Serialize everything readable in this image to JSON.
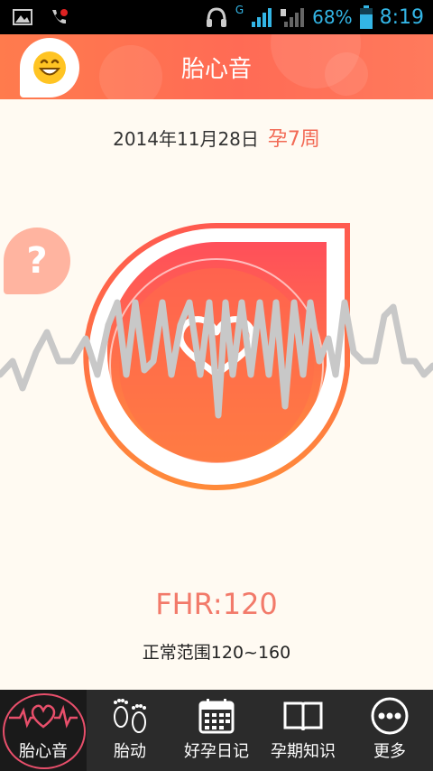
{
  "status_bar": {
    "battery": "68%",
    "time": "8:19",
    "network": "G"
  },
  "header": {
    "title": "胎心音",
    "avatar_icon": "smiley-face-icon"
  },
  "main": {
    "date": "2014年11月28日",
    "pregnancy_week": "孕7周",
    "help_label": "?",
    "fhr_label": "FHR:120",
    "normal_range": "正常范围120~160"
  },
  "nav": {
    "items": [
      {
        "label": "胎心音",
        "icon": "heartbeat-icon",
        "active": true
      },
      {
        "label": "胎动",
        "icon": "footprints-icon",
        "active": false
      },
      {
        "label": "好孕日记",
        "icon": "calendar-icon",
        "active": false
      },
      {
        "label": "孕期知识",
        "icon": "book-icon",
        "active": false
      },
      {
        "label": "更多",
        "icon": "more-dots-icon",
        "active": false
      }
    ]
  },
  "colors": {
    "accent": "#ff6b55",
    "nav_bg": "#2b2b2b",
    "page_bg": "#fffaf2",
    "wave": "#c8c8c8"
  }
}
